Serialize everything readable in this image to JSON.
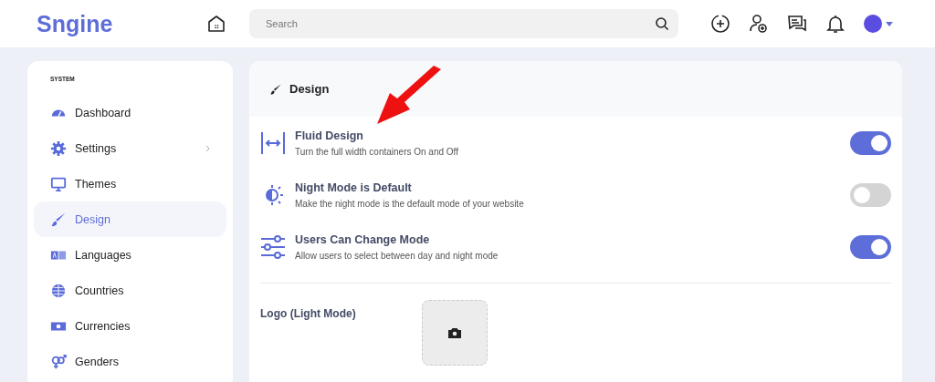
{
  "header": {
    "logo": "Sngine",
    "search": {
      "placeholder": "Search"
    }
  },
  "sidebar": {
    "section": "SYSTEM",
    "items": [
      {
        "label": "Dashboard",
        "selected": false,
        "has_submenu": false
      },
      {
        "label": "Settings",
        "selected": false,
        "has_submenu": true
      },
      {
        "label": "Themes",
        "selected": false,
        "has_submenu": false
      },
      {
        "label": "Design",
        "selected": true,
        "has_submenu": false
      },
      {
        "label": "Languages",
        "selected": false,
        "has_submenu": false
      },
      {
        "label": "Countries",
        "selected": false,
        "has_submenu": false
      },
      {
        "label": "Currencies",
        "selected": false,
        "has_submenu": false
      },
      {
        "label": "Genders",
        "selected": false,
        "has_submenu": false
      }
    ]
  },
  "panel": {
    "title": "Design",
    "settings": [
      {
        "title": "Fluid Design",
        "description": "Turn the full width containers On and Off",
        "on": true
      },
      {
        "title": "Night Mode is Default",
        "description": "Make the night mode is the default mode of your website",
        "on": false
      },
      {
        "title": "Users Can Change Mode",
        "description": "Allow users to select between day and night mode",
        "on": true
      }
    ],
    "uploads": [
      {
        "label": "Logo (Light Mode)"
      }
    ]
  }
}
